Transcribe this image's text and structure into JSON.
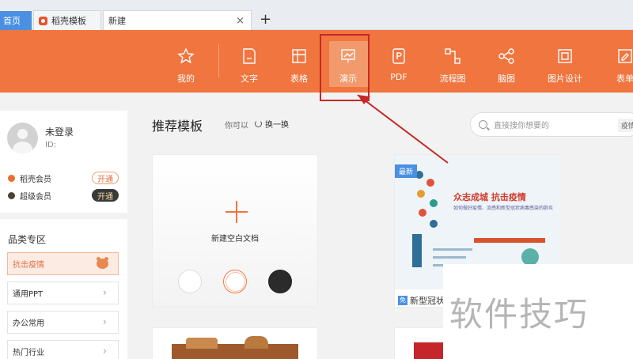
{
  "tabs": {
    "home": "首页",
    "daoke": "稻壳模板",
    "new": "新建",
    "close": "×",
    "add": "+"
  },
  "toolbar": {
    "items": [
      {
        "label": "我的",
        "icon": "star-icon"
      },
      {
        "label": "文字",
        "icon": "doc-icon"
      },
      {
        "label": "表格",
        "icon": "table-icon"
      },
      {
        "label": "演示",
        "icon": "presentation-icon"
      },
      {
        "label": "PDF",
        "icon": "pdf-icon"
      },
      {
        "label": "流程图",
        "icon": "flowchart-icon"
      },
      {
        "label": "脑图",
        "icon": "mindmap-icon"
      },
      {
        "label": "图片设计",
        "icon": "image-design-icon"
      },
      {
        "label": "表单",
        "icon": "form-icon"
      }
    ],
    "active": "演示"
  },
  "user": {
    "name": "未登录",
    "id": "ID:",
    "members": [
      {
        "label": "稻壳会员",
        "button": "开通"
      },
      {
        "label": "超级会员",
        "button": "开通"
      }
    ]
  },
  "categories": {
    "title": "品类专区",
    "items": [
      "抗击疫情",
      "通用PPT",
      "办公常用",
      "热门行业"
    ]
  },
  "main": {
    "title": "推荐模板",
    "hint": "你可以",
    "refresh": "换一换",
    "search_placeholder": "直接搜你想要的",
    "search_tag": "疫情",
    "blank_label": "新建空白文档",
    "template": {
      "badge": "最新",
      "headline": "众志成城 抗击疫情",
      "subline": "如何做好疫情、流感和新型冠状病毒感染的肺炎",
      "free": "免",
      "title": "新型冠状"
    }
  },
  "watermark": "软件技巧",
  "colors": {
    "accent": "#f0753f",
    "highlight": "#c62828",
    "tab_blue": "#4a90e2"
  }
}
